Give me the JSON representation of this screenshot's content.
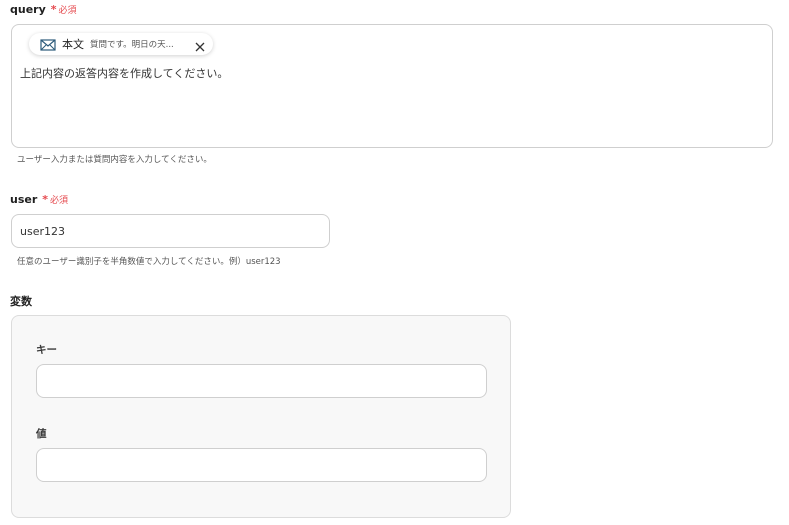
{
  "query": {
    "label": "query",
    "required_star": "*",
    "required_text": "必須",
    "chip": {
      "icon": "mail-icon",
      "label": "本文",
      "value": "質問です。明日の天..."
    },
    "text": "上記内容の返答内容を作成してください。",
    "helper": "ユーザー入力または質問内容を入力してください。"
  },
  "user": {
    "label": "user",
    "required_star": "*",
    "required_text": "必須",
    "value": "user123",
    "helper": "任意のユーザー識別子を半角数値で入力してください。例）user123"
  },
  "variables": {
    "label": "変数",
    "key_label": "キー",
    "key_value": "",
    "value_label": "値",
    "value_value": ""
  },
  "colors": {
    "required": "#e5484d",
    "border": "#cfcfcf",
    "panel_bg": "#f8f8f8"
  }
}
